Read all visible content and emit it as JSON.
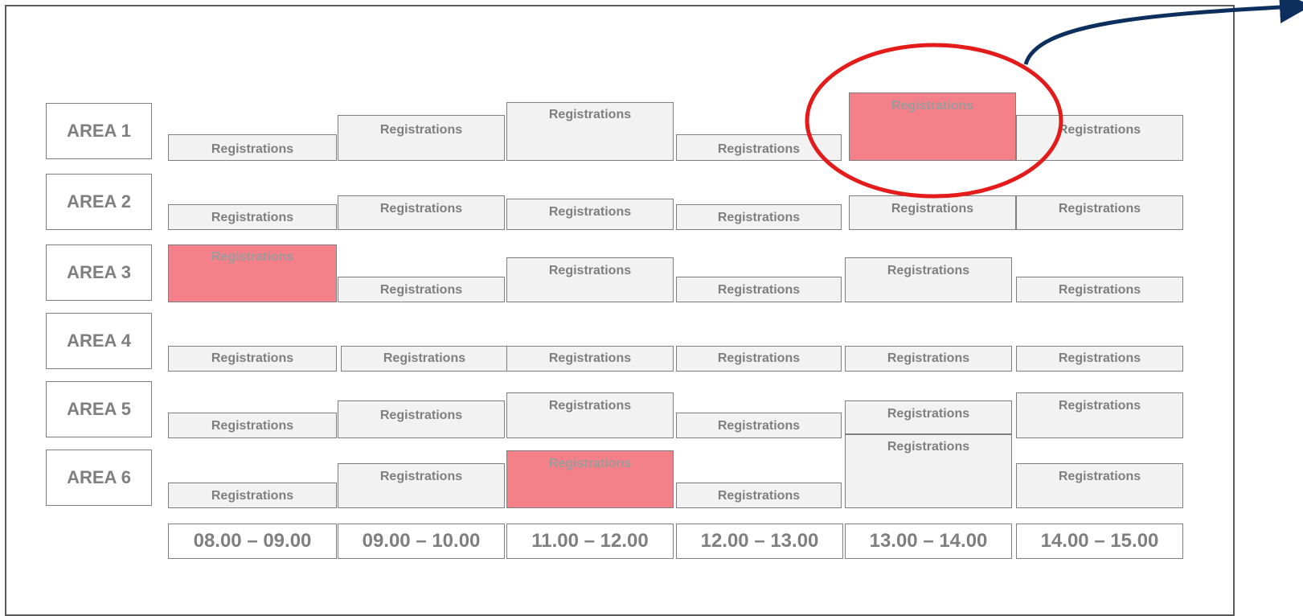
{
  "areas": [
    "AREA 1",
    "AREA 2",
    "AREA 3",
    "AREA 4",
    "AREA 5",
    "AREA 6"
  ],
  "time_slots": [
    "08.00 – 09.00",
    "09.00 – 10.00",
    "11.00 – 12.00",
    "12.00 – 13.00",
    "13.00 – 14.00",
    "14.00 – 15.00"
  ],
  "block_label": "Registrations",
  "highlighted_cells": [
    {
      "area": "AREA 1",
      "slot": "13.00 – 14.00"
    },
    {
      "area": "AREA 3",
      "slot": "08.00 – 09.00"
    },
    {
      "area": "AREA 6",
      "slot": "11.00 – 12.00"
    }
  ],
  "colors": {
    "highlight": "#f4808a",
    "cell": "#f2f2f2",
    "circle": "#e41b1b",
    "arrow": "#0d2f5e",
    "text": "#7f7f7f"
  }
}
